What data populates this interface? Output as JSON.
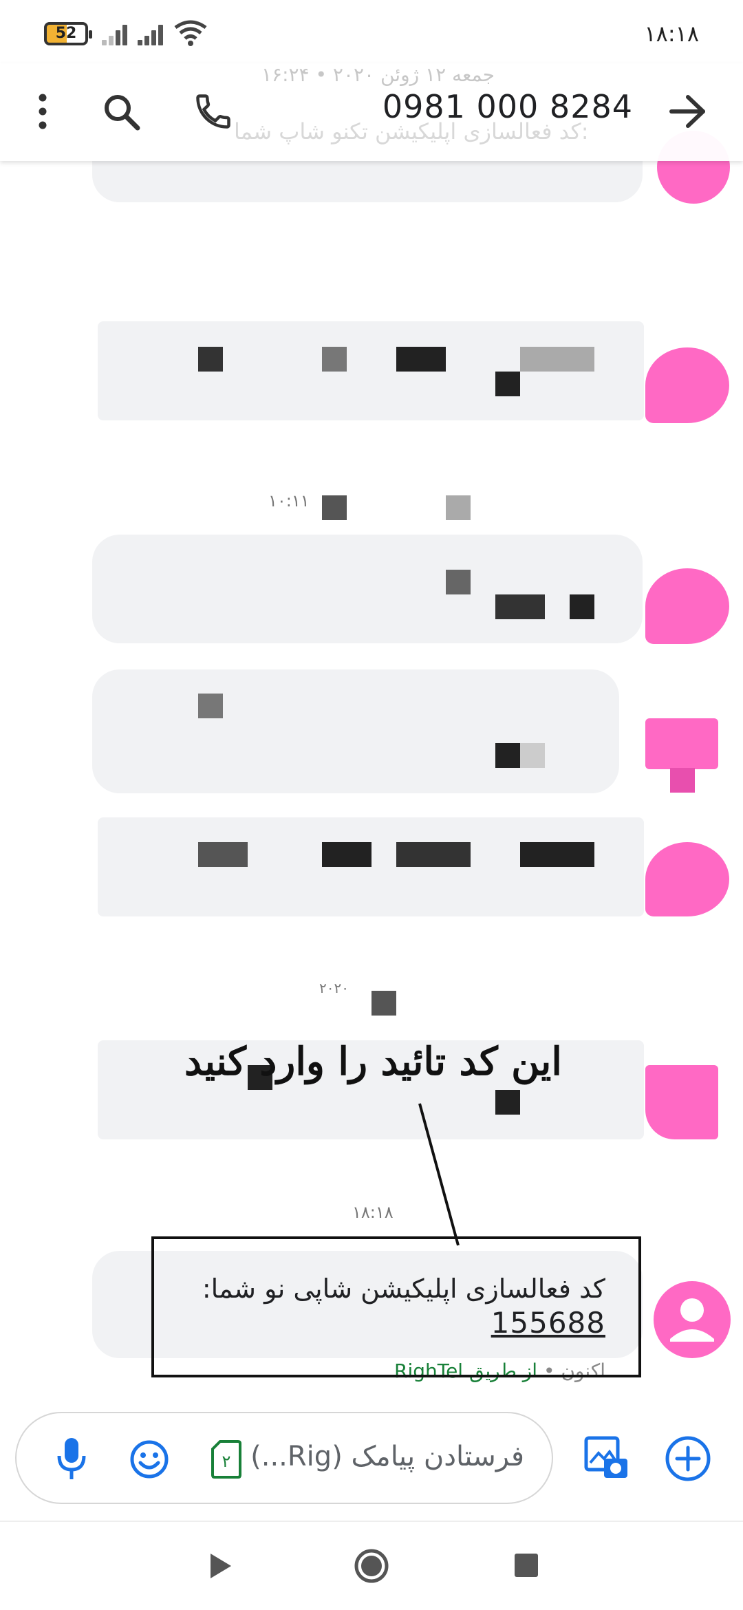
{
  "status_bar": {
    "battery": "52",
    "time": "۱۸:۱۸"
  },
  "app_bar": {
    "title": "0981 000 8284",
    "ghost_date": "جمعه ۱۲ ژوئن ۲۰۲۰ • ۱۶:۲۴",
    "ghost_text": "کد فعالسازی اپلیکیشن تکنو شاپ شما:"
  },
  "conversation": {
    "timestamp_1": "۱۰:۱۱",
    "timestamp_2": "۲۰۲۰",
    "timestamp_last": "۱۸:۱۸",
    "annotation": "این کد تائید را وارد کنید",
    "last_message": {
      "text": "کد فعالسازی اپلیکیشن شاپی نو شما:",
      "code": "155688",
      "time": "اکنون",
      "via": "از طریق RighTel"
    }
  },
  "compose": {
    "placeholder": "فرستادن پیامک (Rig...)"
  },
  "colors": {
    "accent": "#1a73e8",
    "avatar": "#ff69c4",
    "bubble": "#f1f2f4",
    "via": "#188038"
  },
  "icons": [
    "more-vert-icon",
    "search-icon",
    "phone-icon",
    "back-arrow-icon",
    "mic-icon",
    "emoji-icon",
    "sim-2-icon",
    "gallery-camera-icon",
    "add-circle-icon",
    "nav-back-icon",
    "nav-home-icon",
    "nav-recents-icon"
  ]
}
